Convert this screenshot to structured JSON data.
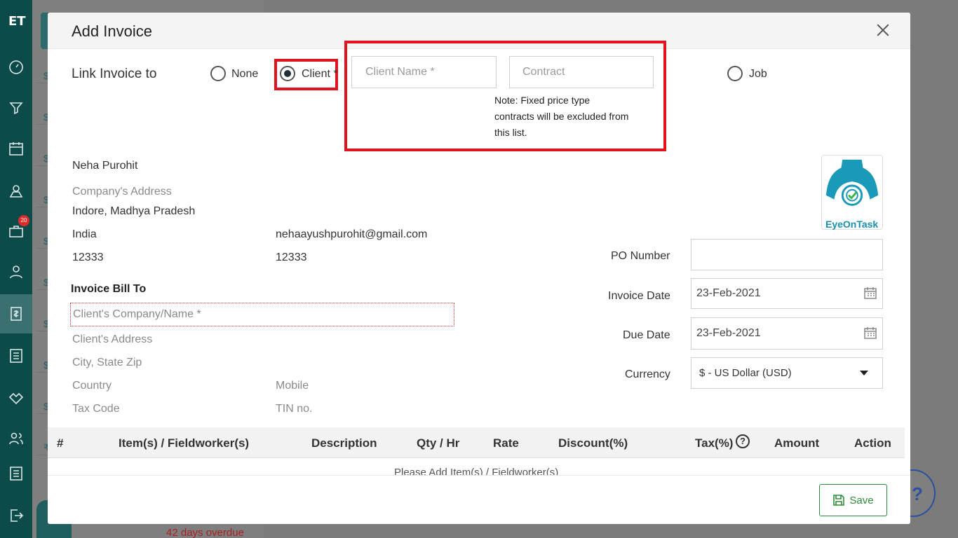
{
  "nav": {
    "logo": "ET",
    "badge_count": "20"
  },
  "background": {
    "overdue_text": "42 days overdue",
    "row_currency": "$",
    "row_currency_inr": "₹"
  },
  "modal": {
    "title": "Add Invoice",
    "link_label": "Link Invoice to",
    "radio_none": "None",
    "radio_client": "Client *",
    "radio_job": "Job",
    "client_name_placeholder": "Client Name *",
    "contract_placeholder": "Contract",
    "note": [
      "Note: Fixed price type",
      "contracts will be excluded from",
      "this list."
    ]
  },
  "company": {
    "name": "Neha Purohit",
    "address_label": "Company's Address",
    "city_state": "Indore, Madhya Pradesh",
    "country": "India",
    "email": "nehaayushpurohit@gmail.com",
    "zip": "12333",
    "phone": "12333",
    "logo_text": "EyeOnTask"
  },
  "bill_to": {
    "heading": "Invoice Bill To",
    "client_placeholder": "Client's Company/Name *",
    "address": "Client's Address",
    "city_state_zip": "City, State Zip",
    "country": "Country",
    "mobile": "Mobile",
    "tax_code": "Tax Code",
    "tin": "TIN no."
  },
  "invoice_meta": {
    "po_label": "PO Number",
    "po_value": "",
    "invoice_date_label": "Invoice Date",
    "invoice_date": "23-Feb-2021",
    "due_date_label": "Due Date",
    "due_date": "23-Feb-2021",
    "currency_label": "Currency",
    "currency": "$ - US Dollar (USD)"
  },
  "table": {
    "columns": [
      "#",
      "Item(s) / Fieldworker(s)",
      "Description",
      "Qty / Hr",
      "Rate",
      "Discount(%)",
      "Tax(%)",
      "Amount",
      "Action"
    ],
    "empty_text": "Please Add Item(s) / Fieldworker(s)"
  },
  "footer": {
    "save_label": "Save",
    "help_glyph": "?"
  },
  "colors": {
    "highlight": "#e0141e",
    "nav_bg": "#0d4a4a",
    "save": "#2e8b3a"
  }
}
